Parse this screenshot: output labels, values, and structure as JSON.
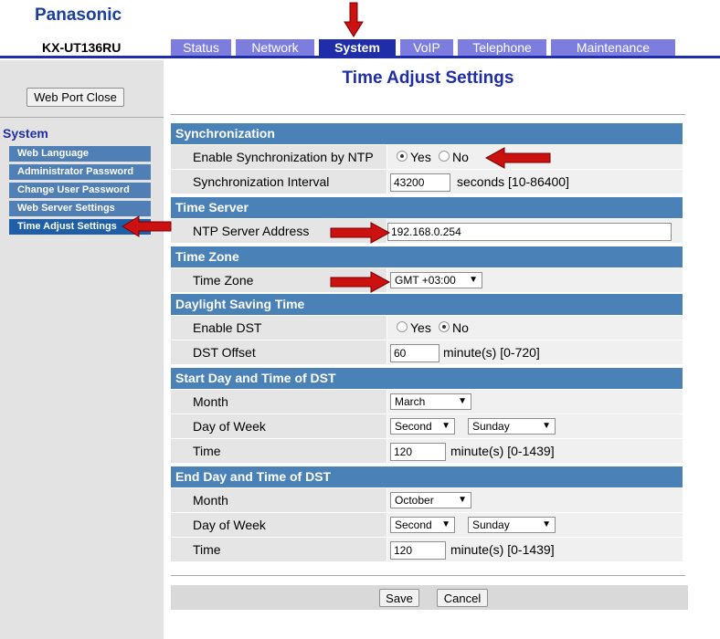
{
  "brand": "Panasonic",
  "model": "KX-UT136RU",
  "tabs": [
    {
      "label": "Status"
    },
    {
      "label": "Network"
    },
    {
      "label": "System"
    },
    {
      "label": "VoIP"
    },
    {
      "label": "Telephone"
    },
    {
      "label": "Maintenance"
    }
  ],
  "sidebar": {
    "port_close": "Web Port Close",
    "section_title": "System",
    "items": [
      {
        "label": "Web Language"
      },
      {
        "label": "Administrator Password"
      },
      {
        "label": "Change User Password"
      },
      {
        "label": "Web Server Settings"
      },
      {
        "label": "Time Adjust Settings"
      }
    ]
  },
  "page_title": "Time Adjust Settings",
  "sync": {
    "header": "Synchronization",
    "enable_label": "Enable Synchronization by NTP",
    "yes": "Yes",
    "no": "No",
    "selected": "Yes",
    "interval_label": "Synchronization Interval",
    "interval_value": "43200",
    "interval_unit": "seconds [10-86400]"
  },
  "time_server": {
    "header": "Time Server",
    "ntp_label": "NTP Server Address",
    "ntp_value": "192.168.0.254"
  },
  "time_zone": {
    "header": "Time Zone",
    "label": "Time Zone",
    "value": "GMT +03:00"
  },
  "dst": {
    "header": "Daylight Saving Time",
    "enable_label": "Enable DST",
    "yes": "Yes",
    "no": "No",
    "selected": "No",
    "offset_label": "DST Offset",
    "offset_value": "60",
    "offset_unit": "minute(s) [0-720]"
  },
  "dst_start": {
    "header": "Start Day and Time of DST",
    "month_label": "Month",
    "month_value": "March",
    "dow_label": "Day of Week",
    "week_value": "Second",
    "day_value": "Sunday",
    "time_label": "Time",
    "time_value": "120",
    "time_unit": "minute(s) [0-1439]"
  },
  "dst_end": {
    "header": "End Day and Time of DST",
    "month_label": "Month",
    "month_value": "October",
    "dow_label": "Day of Week",
    "week_value": "Second",
    "day_value": "Sunday",
    "time_label": "Time",
    "time_value": "120",
    "time_unit": "minute(s) [0-1439]"
  },
  "buttons": {
    "save": "Save",
    "cancel": "Cancel"
  },
  "colors": {
    "brand": "#1a3f9c",
    "tab": "#7d7de0",
    "tab_active": "#1f2ea8",
    "section": "#4a82b8",
    "nav": "#4f7fb5",
    "annotation_arrow": "#cc1111"
  }
}
